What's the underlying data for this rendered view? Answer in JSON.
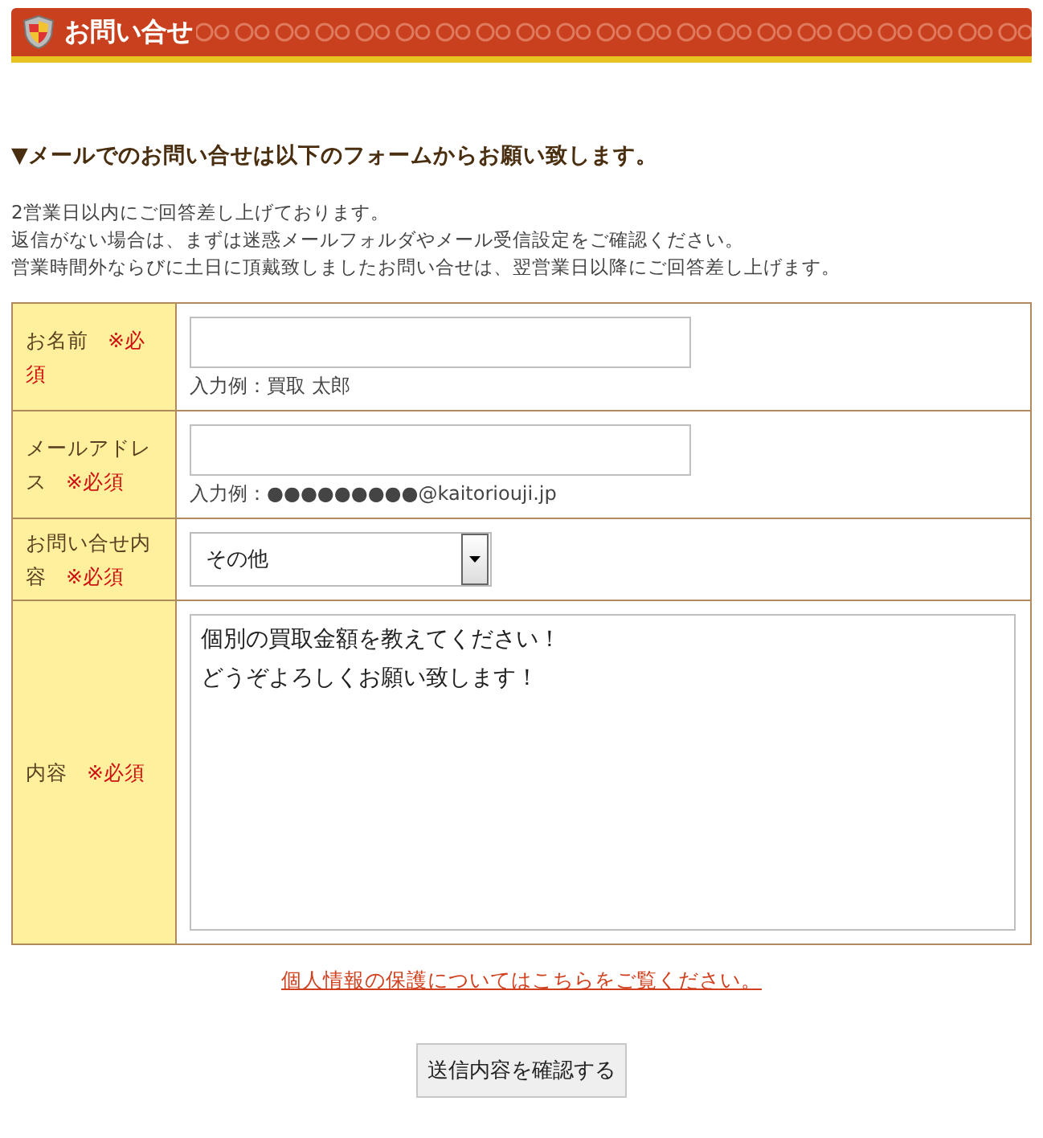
{
  "header": {
    "title": "お問い合せ"
  },
  "heading": "▼メールでのお問い合せは以下のフォームからお願い致します。",
  "notes": [
    "2営業日以内にご回答差し上げております。",
    "返信がない場合は、まずは迷惑メールフォルダやメール受信設定をご確認ください。",
    "営業時間外ならびに土日に頂戴致しましたお問い合せは、翌営業日以降にご回答差し上げます。"
  ],
  "fields": [
    {
      "kind": "text",
      "label": "お名前",
      "required": "※必須",
      "hint": "入力例：買取 太郎"
    },
    {
      "kind": "text",
      "label": "メールアドレス",
      "required": "※必須",
      "hint": "入力例：●●●●●●●●●@kaitoriouji.jp"
    },
    {
      "kind": "select",
      "label": "お問い合せ内容",
      "required": "※必須",
      "value": "その他"
    },
    {
      "kind": "textarea",
      "label": "内容",
      "required": "※必須",
      "lines": [
        "個別の買取金額を教えてください！",
        "どうぞよろしくお願い致します！"
      ]
    }
  ],
  "privacy_link": "個人情報の保護についてはこちらをご覧ください。",
  "submit_button": "送信内容を確認する"
}
